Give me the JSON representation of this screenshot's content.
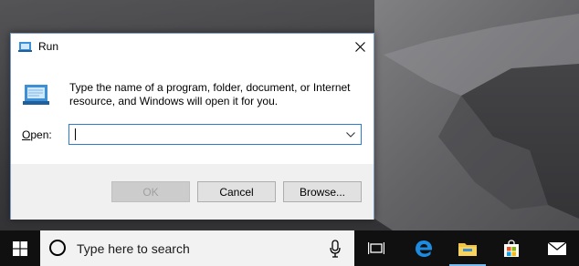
{
  "window": {
    "title": "Run",
    "description": "Type the name of a program, folder, document, or Internet resource, and Windows will open it for you.",
    "open_label_accel": "O",
    "open_label_rest": "pen:",
    "input_value": "",
    "buttons": {
      "ok": "OK",
      "cancel": "Cancel",
      "browse": "Browse..."
    },
    "accent_color": "#2d7bd1"
  },
  "taskbar": {
    "search_placeholder": "Type here to search",
    "icons": [
      "windows-logo-icon",
      "cortana-icon",
      "microphone-icon",
      "task-view-icon",
      "edge-icon",
      "file-explorer-icon",
      "store-icon",
      "mail-icon"
    ],
    "active_app": "file-explorer"
  }
}
